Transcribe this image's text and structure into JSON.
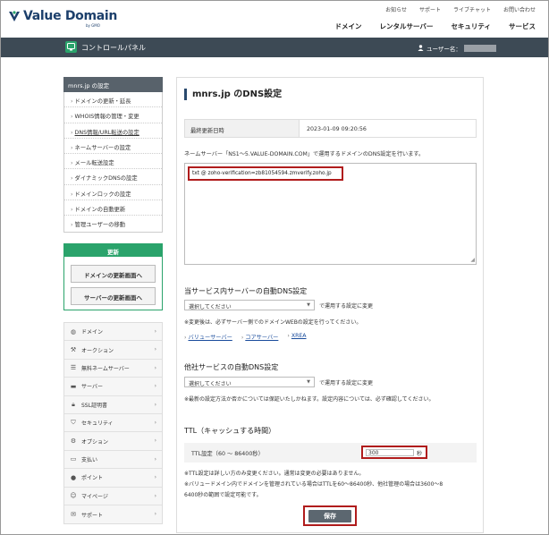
{
  "header": {
    "logo_text": "Value Domain",
    "logo_sub": "by GMO",
    "top_links": [
      "お知らせ",
      "サポート",
      "ライブチャット",
      "お問い合わせ"
    ],
    "main_nav": [
      "ドメイン",
      "レンタルサーバー",
      "セキュリティ",
      "サービス"
    ]
  },
  "bar": {
    "title": "コントロールパネル",
    "user_label": "ユーザー名："
  },
  "sidebar": {
    "title": "mnrs.jp の設定",
    "items": [
      "ドメインの更新・延長",
      "WHOIS情報の管理・変更",
      "DNS情報/URL転送の設定",
      "ネームサーバーの設定",
      "メール転送設定",
      "ダイナミックDNSの設定",
      "ドメインロックの設定",
      "ドメインの自動更新",
      "管理ユーザーの移動"
    ],
    "renew": {
      "title": "更新",
      "button1": "ドメインの更新画面へ",
      "button2": "サーバーの更新画面へ"
    },
    "services": [
      "ドメイン",
      "オークション",
      "無料ネームサーバー",
      "サーバー",
      "SSL証明書",
      "セキュリティ",
      "オプション",
      "支払い",
      "ポイント",
      "マイページ",
      "サポート"
    ]
  },
  "main": {
    "title": "mnrs.jp のDNS設定",
    "updated_label": "最終更新日時",
    "updated_value": "2023-01-09 09:20:56",
    "ns_note": "ネームサーバー「NS1〜5.VALUE-DOMAIN.COM」で運用するドメインのDNS設定を行います。",
    "dns_record": "txt @ zoho-verification=zb81054594.zmverify.zoho.jp",
    "auto_dns_title": "当サービス内サーバーの自動DNS設定",
    "select_placeholder": "選択してください",
    "apply_note": "で運用する設定に変更",
    "auto_dns_note": "※変更後は、必ずサーバー側でのドメインWEBの設定を行ってください。",
    "links": [
      "バリューサーバー",
      "コアサーバー",
      "XREA"
    ],
    "other_dns_title": "他社サービスの自動DNS設定",
    "select_placeholder2": "選択してください",
    "apply_note2": "で運用する設定に変更",
    "other_dns_note": "※最新の設定方法か否かについては保証いたしかねます。設定内容については、必ず確認してください。",
    "ttl_title": "TTL（キャッシュする時間）",
    "ttl_label": "TTL設定（60 〜 86400秒）",
    "ttl_value": "300",
    "ttl_unit": "秒",
    "ttl_note1": "※TTL設定は詳しい方のみ変更ください。通常は変更の必要はありません。",
    "ttl_note2": "※バリュードメイン内でドメインを管理されている場合はTTLを60〜86400秒、他社管理の場合は3600〜8",
    "ttl_note3": "6400秒の範囲で設定可能です。",
    "save_label": "保存"
  },
  "colors": {
    "brand": "#1c3f6b",
    "bar": "#3d4a55",
    "green": "#2aa36b",
    "highlight": "#b01c1c"
  }
}
